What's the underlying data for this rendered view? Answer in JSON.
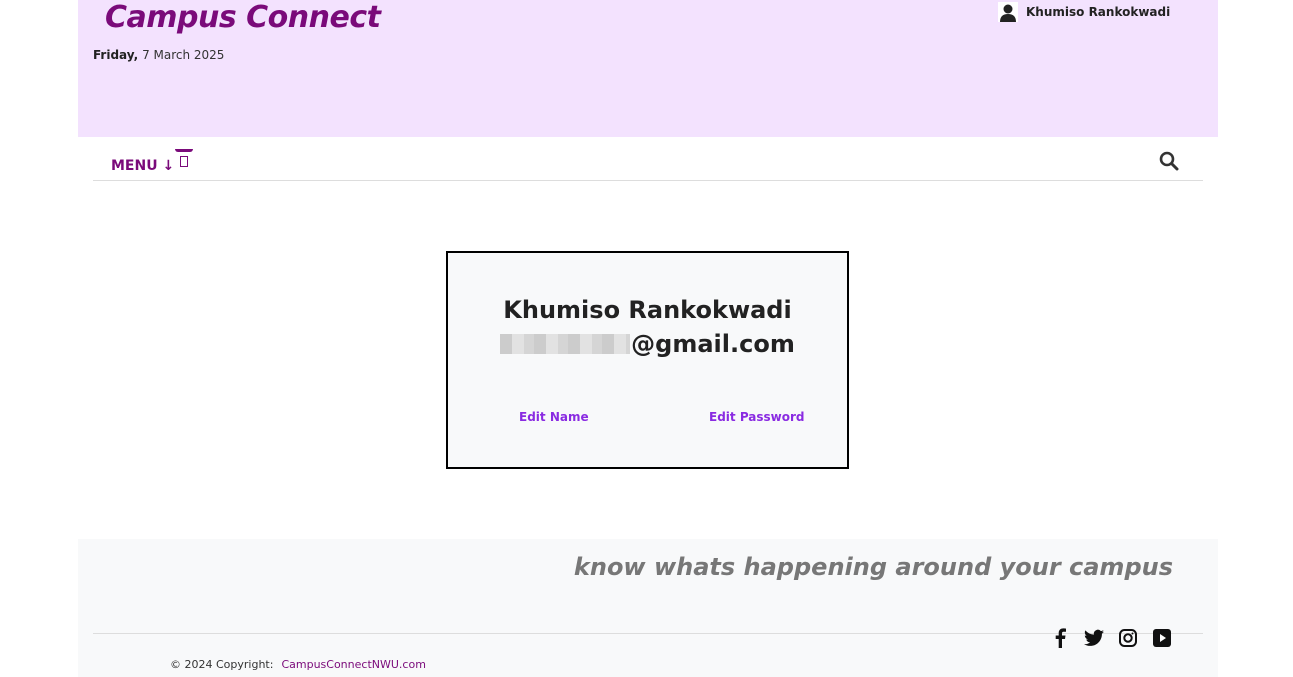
{
  "header": {
    "brand": "Campus Connect",
    "day": "Friday,",
    "date": "7 March 2025",
    "user_name": "Khumiso Rankokwadi"
  },
  "nav": {
    "menu_label": "MENU ↓"
  },
  "profile": {
    "name": "Khumiso Rankokwadi",
    "email_visible": "@gmail.com",
    "edit_name": "Edit Name",
    "edit_password": "Edit Password"
  },
  "footer": {
    "tagline": "know whats happening around your campus",
    "copyright": "© 2024 Copyright:",
    "site_link": "CampusConnectNWU.com"
  },
  "colors": {
    "brand": "#7a0a7a",
    "header_bg": "#f3e2fe",
    "link": "#8a2be2"
  }
}
